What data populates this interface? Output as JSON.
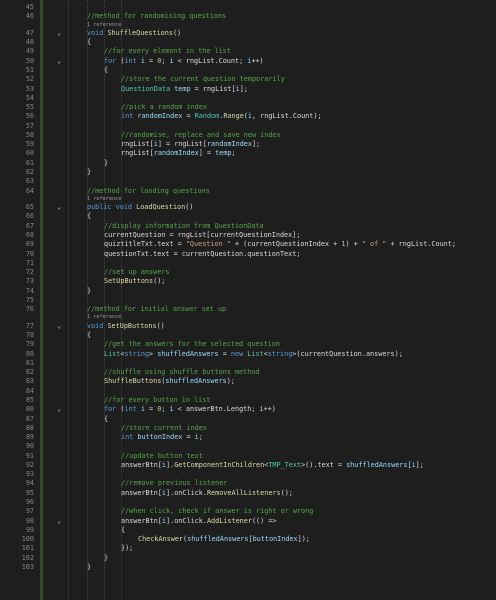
{
  "editor": {
    "lines": [
      {
        "n": "45",
        "fold": "",
        "seg": []
      },
      {
        "n": "46",
        "fold": "",
        "seg": [
          [
            "cm",
            "//method for randomising questions"
          ]
        ],
        "ref": "1 reference"
      },
      {
        "n": "47",
        "fold": "⌄",
        "seg": [
          [
            "kw",
            "void "
          ],
          [
            "me",
            "ShuffleQuestions"
          ],
          [
            "ct",
            "()"
          ]
        ]
      },
      {
        "n": "48",
        "fold": "",
        "seg": [
          [
            "ct",
            "{"
          ]
        ]
      },
      {
        "n": "49",
        "fold": "",
        "seg": [
          [
            "cm",
            "//for every element in the list"
          ]
        ]
      },
      {
        "n": "50",
        "fold": "⌄",
        "seg": [
          [
            "kw",
            "for "
          ],
          [
            "ct",
            "("
          ],
          [
            "kw",
            "int "
          ],
          [
            "lv",
            "i"
          ],
          [
            "ct",
            " = "
          ],
          [
            "nu",
            "0"
          ],
          [
            "ct",
            "; "
          ],
          [
            "lv",
            "i"
          ],
          [
            "ct",
            " < rngList.Count; "
          ],
          [
            "lv",
            "i"
          ],
          [
            "ct",
            "++)"
          ]
        ]
      },
      {
        "n": "51",
        "fold": "",
        "seg": [
          [
            "ct",
            "{"
          ]
        ]
      },
      {
        "n": "52",
        "fold": "",
        "seg": [
          [
            "cm",
            "//store the current question temporarily"
          ]
        ]
      },
      {
        "n": "53",
        "fold": "",
        "seg": [
          [
            "ty",
            "QuestionData "
          ],
          [
            "lv",
            "temp"
          ],
          [
            "ct",
            " = rngList["
          ],
          [
            "lv",
            "i"
          ],
          [
            "ct",
            "];"
          ]
        ]
      },
      {
        "n": "54",
        "fold": "",
        "seg": []
      },
      {
        "n": "55",
        "fold": "",
        "seg": [
          [
            "cm",
            "//pick a random index"
          ]
        ]
      },
      {
        "n": "56",
        "fold": "",
        "seg": [
          [
            "kw",
            "int "
          ],
          [
            "lv",
            "randomIndex"
          ],
          [
            "ct",
            " = "
          ],
          [
            "ty",
            "Random"
          ],
          [
            "ct",
            "."
          ],
          [
            "me",
            "Range"
          ],
          [
            "ct",
            "("
          ],
          [
            "lv",
            "i"
          ],
          [
            "ct",
            ", rngList.Count);"
          ]
        ]
      },
      {
        "n": "57",
        "fold": "",
        "seg": []
      },
      {
        "n": "58",
        "fold": "",
        "seg": [
          [
            "cm",
            "//randomise, replace and save new index"
          ]
        ]
      },
      {
        "n": "59",
        "fold": "",
        "seg": [
          [
            "ct",
            "rngList["
          ],
          [
            "lv",
            "i"
          ],
          [
            "ct",
            "] = rngList["
          ],
          [
            "lv",
            "randomIndex"
          ],
          [
            "ct",
            "];"
          ]
        ]
      },
      {
        "n": "60",
        "fold": "",
        "seg": [
          [
            "ct",
            "rngList["
          ],
          [
            "lv",
            "randomIndex"
          ],
          [
            "ct",
            "] = "
          ],
          [
            "lv",
            "temp"
          ],
          [
            "ct",
            ";"
          ]
        ]
      },
      {
        "n": "61",
        "fold": "",
        "seg": [
          [
            "ct",
            "}"
          ]
        ]
      },
      {
        "n": "62",
        "fold": "",
        "seg": [
          [
            "ct",
            "}"
          ]
        ]
      },
      {
        "n": "63",
        "fold": "",
        "seg": []
      },
      {
        "n": "64",
        "fold": "",
        "seg": [
          [
            "cm",
            "//method for laoding questions"
          ]
        ],
        "ref": "1 reference"
      },
      {
        "n": "65",
        "fold": "⌄",
        "seg": [
          [
            "kw",
            "public void "
          ],
          [
            "me",
            "LoadQuestion"
          ],
          [
            "ct",
            "()"
          ]
        ]
      },
      {
        "n": "66",
        "fold": "",
        "seg": [
          [
            "ct",
            "{"
          ]
        ]
      },
      {
        "n": "67",
        "fold": "",
        "seg": [
          [
            "cm",
            "//display information from QuestionData"
          ]
        ]
      },
      {
        "n": "68",
        "fold": "",
        "seg": [
          [
            "ct",
            "currentQuestion = rngList[currentQuestionIndex];"
          ]
        ]
      },
      {
        "n": "69",
        "fold": "",
        "seg": [
          [
            "ct",
            "quiztitleTxt.text = "
          ],
          [
            "st",
            "\"Question \""
          ],
          [
            "ct",
            " + (currentQuestionIndex + "
          ],
          [
            "nu",
            "1"
          ],
          [
            "ct",
            ") + "
          ],
          [
            "st",
            "\" of \""
          ],
          [
            "ct",
            " + rngList.Count;"
          ]
        ]
      },
      {
        "n": "70",
        "fold": "",
        "seg": [
          [
            "ct",
            "questionTxt.text = currentQuestion.questionText;"
          ]
        ]
      },
      {
        "n": "71",
        "fold": "",
        "seg": []
      },
      {
        "n": "72",
        "fold": "",
        "seg": [
          [
            "cm",
            "//set up answers"
          ]
        ]
      },
      {
        "n": "73",
        "fold": "",
        "seg": [
          [
            "me",
            "SetUpButtons"
          ],
          [
            "ct",
            "();"
          ]
        ]
      },
      {
        "n": "74",
        "fold": "",
        "seg": [
          [
            "ct",
            "}"
          ]
        ]
      },
      {
        "n": "75",
        "fold": "",
        "seg": []
      },
      {
        "n": "76",
        "fold": "",
        "seg": [
          [
            "cm",
            "//method for initial answer set up"
          ]
        ],
        "ref": "1 reference"
      },
      {
        "n": "77",
        "fold": "⌄",
        "seg": [
          [
            "kw",
            "void "
          ],
          [
            "me",
            "SetUpButtons"
          ],
          [
            "ct",
            "()"
          ]
        ]
      },
      {
        "n": "78",
        "fold": "",
        "seg": [
          [
            "ct",
            "{"
          ]
        ]
      },
      {
        "n": "79",
        "fold": "",
        "seg": [
          [
            "cm",
            "//get the answers for the selected question"
          ]
        ]
      },
      {
        "n": "80",
        "fold": "",
        "seg": [
          [
            "ty",
            "List"
          ],
          [
            "ct",
            "<"
          ],
          [
            "kw",
            "string"
          ],
          [
            "ct",
            "> "
          ],
          [
            "lv",
            "shuffledAnswers"
          ],
          [
            "ct",
            " = "
          ],
          [
            "kw",
            "new "
          ],
          [
            "ty",
            "List"
          ],
          [
            "ct",
            "<"
          ],
          [
            "kw",
            "string"
          ],
          [
            "ct",
            ">(currentQuestion.answers);"
          ]
        ]
      },
      {
        "n": "81",
        "fold": "",
        "seg": []
      },
      {
        "n": "82",
        "fold": "",
        "seg": [
          [
            "cm",
            "//shuffle using shuffle buttons method"
          ]
        ]
      },
      {
        "n": "83",
        "fold": "",
        "seg": [
          [
            "me",
            "ShuffleButtons"
          ],
          [
            "ct",
            "("
          ],
          [
            "lv",
            "shuffledAnswers"
          ],
          [
            "ct",
            ");"
          ]
        ]
      },
      {
        "n": "84",
        "fold": "",
        "seg": []
      },
      {
        "n": "85",
        "fold": "",
        "seg": [
          [
            "cm",
            "//for every button in list"
          ]
        ]
      },
      {
        "n": "86",
        "fold": "⌄",
        "seg": [
          [
            "kw",
            "for "
          ],
          [
            "ct",
            "("
          ],
          [
            "kw",
            "int "
          ],
          [
            "lv",
            "i"
          ],
          [
            "ct",
            " = "
          ],
          [
            "nu",
            "0"
          ],
          [
            "ct",
            "; "
          ],
          [
            "lv",
            "i"
          ],
          [
            "ct",
            " < answerBtn.Length; "
          ],
          [
            "lv",
            "i"
          ],
          [
            "ct",
            "++)"
          ]
        ]
      },
      {
        "n": "87",
        "fold": "",
        "seg": [
          [
            "ct",
            "{"
          ]
        ]
      },
      {
        "n": "88",
        "fold": "",
        "seg": [
          [
            "cm",
            "//store current index"
          ]
        ]
      },
      {
        "n": "89",
        "fold": "",
        "seg": [
          [
            "kw",
            "int "
          ],
          [
            "lv",
            "buttonIndex"
          ],
          [
            "ct",
            " = "
          ],
          [
            "lv",
            "i"
          ],
          [
            "ct",
            ";"
          ]
        ]
      },
      {
        "n": "90",
        "fold": "",
        "seg": []
      },
      {
        "n": "91",
        "fold": "",
        "seg": [
          [
            "cm",
            "//update button text"
          ]
        ]
      },
      {
        "n": "92",
        "fold": "",
        "seg": [
          [
            "ct",
            "answerBtn["
          ],
          [
            "lv",
            "i"
          ],
          [
            "ct",
            "]."
          ],
          [
            "me",
            "GetComponentInChildren"
          ],
          [
            "ct",
            "<"
          ],
          [
            "ty",
            "TMP_Text"
          ],
          [
            "ct",
            ">().text = "
          ],
          [
            "lv",
            "shuffledAnswers"
          ],
          [
            "ct",
            "["
          ],
          [
            "lv",
            "i"
          ],
          [
            "ct",
            "];"
          ]
        ]
      },
      {
        "n": "93",
        "fold": "",
        "seg": []
      },
      {
        "n": "94",
        "fold": "",
        "seg": [
          [
            "cm",
            "//remove previous listener"
          ]
        ]
      },
      {
        "n": "95",
        "fold": "",
        "seg": [
          [
            "ct",
            "answerBtn["
          ],
          [
            "lv",
            "i"
          ],
          [
            "ct",
            "].onClick."
          ],
          [
            "me",
            "RemoveAllListeners"
          ],
          [
            "ct",
            "();"
          ]
        ]
      },
      {
        "n": "96",
        "fold": "",
        "seg": []
      },
      {
        "n": "97",
        "fold": "",
        "seg": [
          [
            "cm",
            "//when click, check if answer is right or wrong"
          ]
        ]
      },
      {
        "n": "98",
        "fold": "⌄",
        "seg": [
          [
            "ct",
            "answerBtn["
          ],
          [
            "lv",
            "i"
          ],
          [
            "ct",
            "].onClick."
          ],
          [
            "me",
            "AddListener"
          ],
          [
            "ct",
            "(() =>"
          ]
        ]
      },
      {
        "n": "99",
        "fold": "",
        "seg": [
          [
            "ct",
            "{"
          ]
        ]
      },
      {
        "n": "100",
        "fold": "",
        "seg": [
          [
            "me",
            "CheckAnswer"
          ],
          [
            "ct",
            "("
          ],
          [
            "lv",
            "shuffledAnswers"
          ],
          [
            "ct",
            "["
          ],
          [
            "lv",
            "buttonIndex"
          ],
          [
            "ct",
            "]);"
          ]
        ]
      },
      {
        "n": "101",
        "fold": "",
        "seg": [
          [
            "ct",
            "});"
          ]
        ]
      },
      {
        "n": "102",
        "fold": "",
        "seg": [
          [
            "ct",
            "}"
          ]
        ]
      },
      {
        "n": "103",
        "fold": "",
        "seg": [
          [
            "ct",
            "}"
          ]
        ]
      }
    ]
  }
}
